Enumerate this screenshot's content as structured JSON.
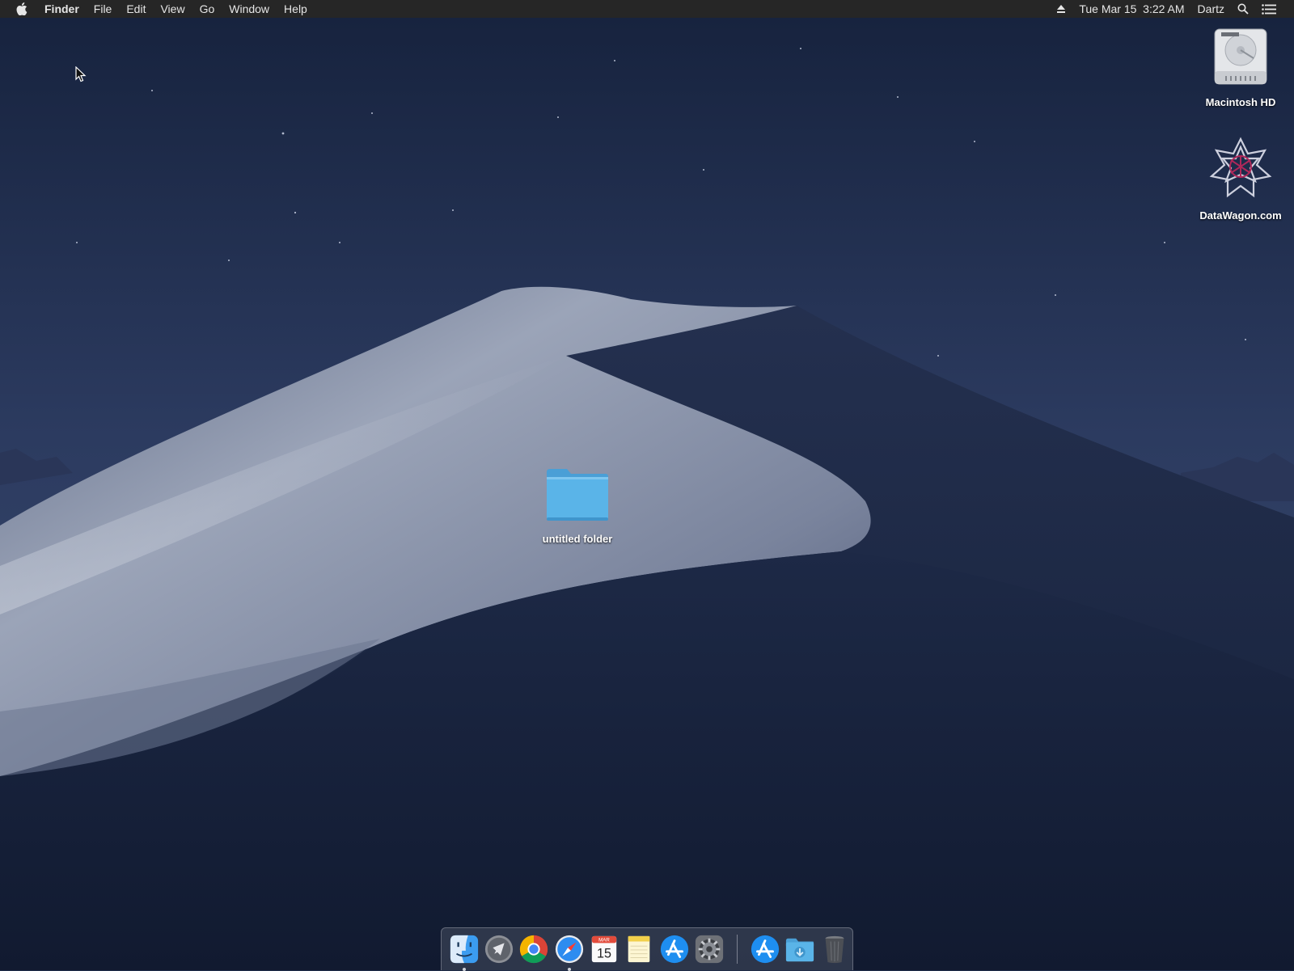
{
  "menubar": {
    "apple_icon": "apple-icon",
    "app_name": "Finder",
    "menus": [
      "File",
      "Edit",
      "View",
      "Go",
      "Window",
      "Help"
    ],
    "eject_icon": "eject-icon",
    "datetime": "Tue Mar 15  3:22 AM",
    "user": "Dartz",
    "search_icon": "spotlight-search-icon",
    "notification_icon": "notification-center-icon"
  },
  "desktop": {
    "icons": [
      {
        "label": "Macintosh HD",
        "icon": "hard-drive-icon"
      },
      {
        "label": "DataWagon.com",
        "icon": "datawagon-logo-icon"
      },
      {
        "label": "untitled folder",
        "icon": "folder-icon"
      }
    ]
  },
  "dock": {
    "items": [
      {
        "name": "Finder",
        "icon": "finder-icon",
        "running": true
      },
      {
        "name": "Launchpad",
        "icon": "launchpad-rocket-icon",
        "running": false
      },
      {
        "name": "Google Chrome",
        "icon": "chrome-icon",
        "running": false
      },
      {
        "name": "Safari",
        "icon": "safari-compass-icon",
        "running": true
      },
      {
        "name": "Calendar",
        "icon": "calendar-icon",
        "running": false,
        "month": "MAR",
        "day": "15"
      },
      {
        "name": "Notes",
        "icon": "notes-icon",
        "running": false
      },
      {
        "name": "App Store",
        "icon": "app-store-icon",
        "running": false
      },
      {
        "name": "System Preferences",
        "icon": "system-preferences-gear-icon",
        "running": false
      },
      {
        "name": "Applications",
        "icon": "app-store-stack-icon",
        "running": false
      },
      {
        "name": "Downloads",
        "icon": "downloads-folder-icon",
        "running": false
      },
      {
        "name": "Trash",
        "icon": "trash-icon",
        "running": false
      }
    ]
  },
  "colors": {
    "sky_top": "#16223d",
    "sky_mid": "#2c3b60",
    "dune_light": "#9aa3b8",
    "dune_shadow": "#1a2541",
    "folder_blue": "#5ab4e8",
    "menubar_bg": "#262626"
  }
}
